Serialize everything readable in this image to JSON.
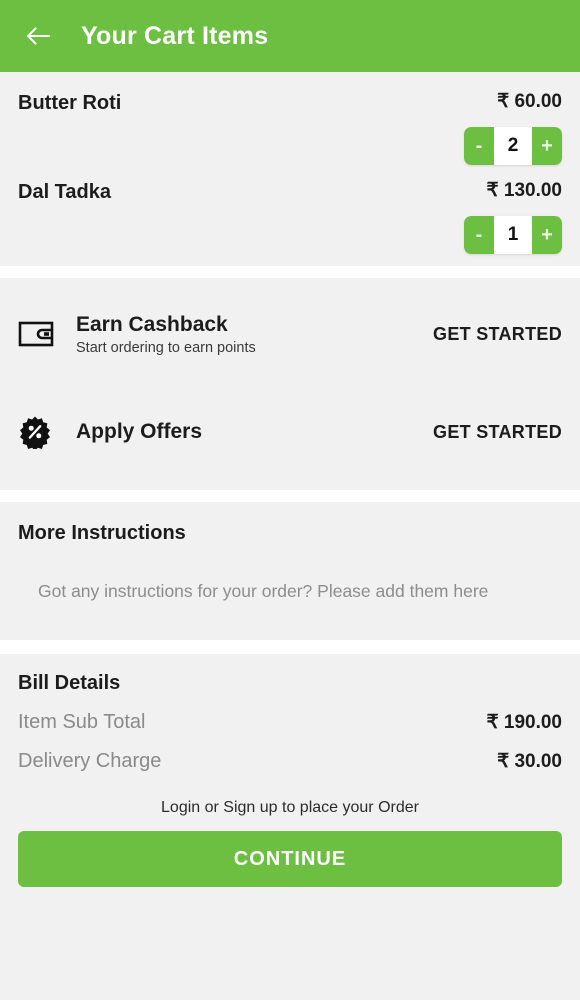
{
  "header": {
    "title": "Your Cart Items",
    "back_icon": "arrow-left-icon",
    "background_color": "#6cbf40"
  },
  "cart": {
    "items": [
      {
        "name": "Butter Roti",
        "price": "₹ 60.00",
        "quantity": "2",
        "decrement_label": "-",
        "increment_label": "+"
      },
      {
        "name": "Dal Tadka",
        "price": "₹ 130.00",
        "quantity": "1",
        "decrement_label": "-",
        "increment_label": "+"
      }
    ]
  },
  "rewards": {
    "cashback": {
      "icon": "wallet-icon",
      "title": "Earn Cashback",
      "subtitle": "Start ordering to earn points",
      "action_label": "GET STARTED"
    },
    "offers": {
      "icon": "discount-badge-icon",
      "title": "Apply Offers",
      "action_label": "GET STARTED"
    }
  },
  "instructions": {
    "title": "More Instructions",
    "placeholder": "Got any instructions for your order? Please add them here",
    "value": ""
  },
  "bill": {
    "title": "Bill Details",
    "rows": [
      {
        "label": "Item Sub Total",
        "value": "₹ 190.00"
      },
      {
        "label": "Delivery Charge",
        "value": "₹ 30.00"
      }
    ]
  },
  "footer": {
    "login_hint": "Login or Sign up to place your Order",
    "continue_label": "CONTINUE",
    "accent_color": "#6cbf40"
  }
}
